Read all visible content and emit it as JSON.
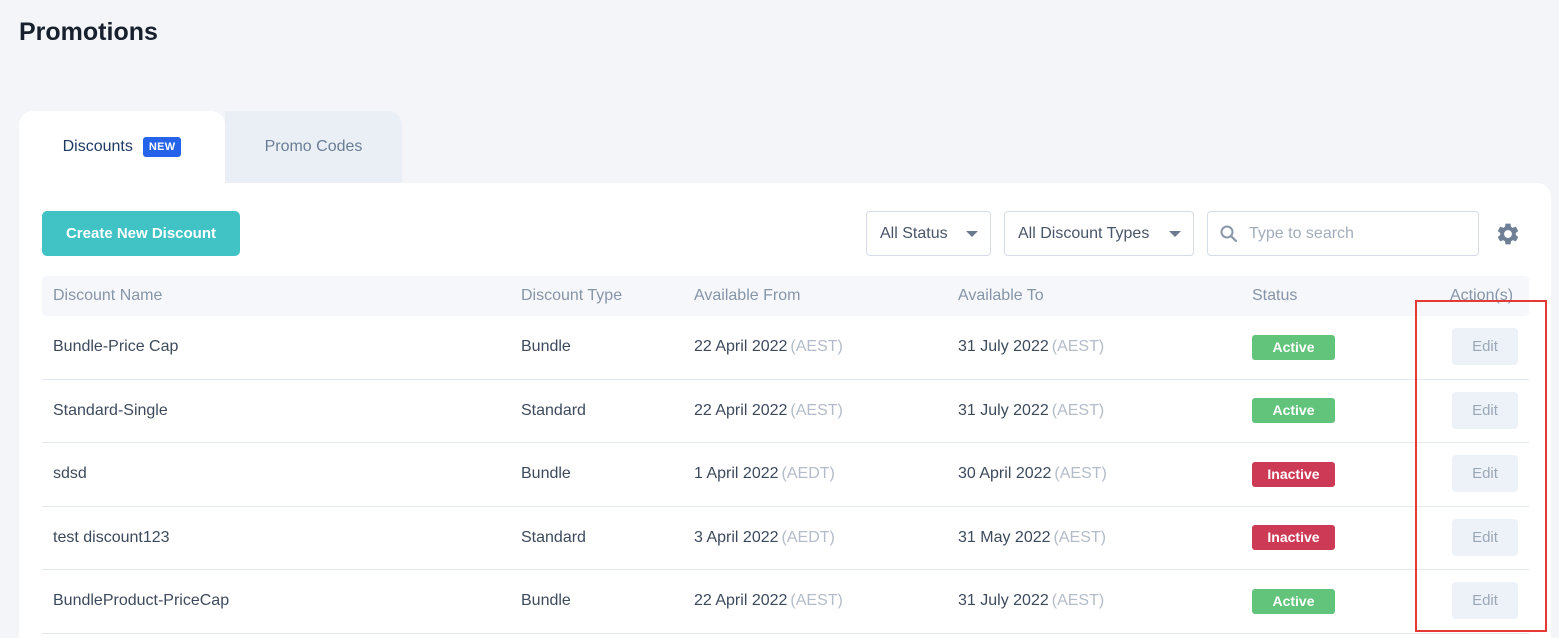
{
  "page": {
    "title": "Promotions"
  },
  "tabs": [
    {
      "label": "Discounts",
      "badge": "NEW"
    },
    {
      "label": "Promo Codes"
    }
  ],
  "toolbar": {
    "create_label": "Create New Discount",
    "status_filter": "All Status",
    "type_filter": "All Discount Types",
    "search_placeholder": "Type to search"
  },
  "table": {
    "headers": [
      "Discount Name",
      "Discount Type",
      "Available From",
      "Available To",
      "Status",
      "Action(s)"
    ],
    "rows": [
      {
        "name": "Bundle-Price Cap",
        "type": "Bundle",
        "from": "22 April 2022",
        "from_tz": "(AEST)",
        "to": "31 July 2022",
        "to_tz": "(AEST)",
        "status": "Active",
        "action": "Edit"
      },
      {
        "name": "Standard-Single",
        "type": "Standard",
        "from": "22 April 2022",
        "from_tz": "(AEST)",
        "to": "31 July 2022",
        "to_tz": "(AEST)",
        "status": "Active",
        "action": "Edit"
      },
      {
        "name": "sdsd",
        "type": "Bundle",
        "from": "1 April 2022",
        "from_tz": "(AEDT)",
        "to": "30 April 2022",
        "to_tz": "(AEST)",
        "status": "Inactive",
        "action": "Edit"
      },
      {
        "name": "test discount123",
        "type": "Standard",
        "from": "3 April 2022",
        "from_tz": "(AEDT)",
        "to": "31 May 2022",
        "to_tz": "(AEST)",
        "status": "Inactive",
        "action": "Edit"
      },
      {
        "name": "BundleProduct-PriceCap",
        "type": "Bundle",
        "from": "22 April 2022",
        "from_tz": "(AEST)",
        "to": "31 July 2022",
        "to_tz": "(AEST)",
        "status": "Active",
        "action": "Edit"
      }
    ]
  },
  "colors": {
    "accent": "#41c3c6",
    "active": "#62c47b",
    "inactive": "#cc3a55",
    "badge_new": "#2563eb",
    "highlight": "#e53935"
  },
  "icons": {
    "search": "search-icon",
    "settings": "gear-icon",
    "dropdown": "chevron-down-icon"
  }
}
